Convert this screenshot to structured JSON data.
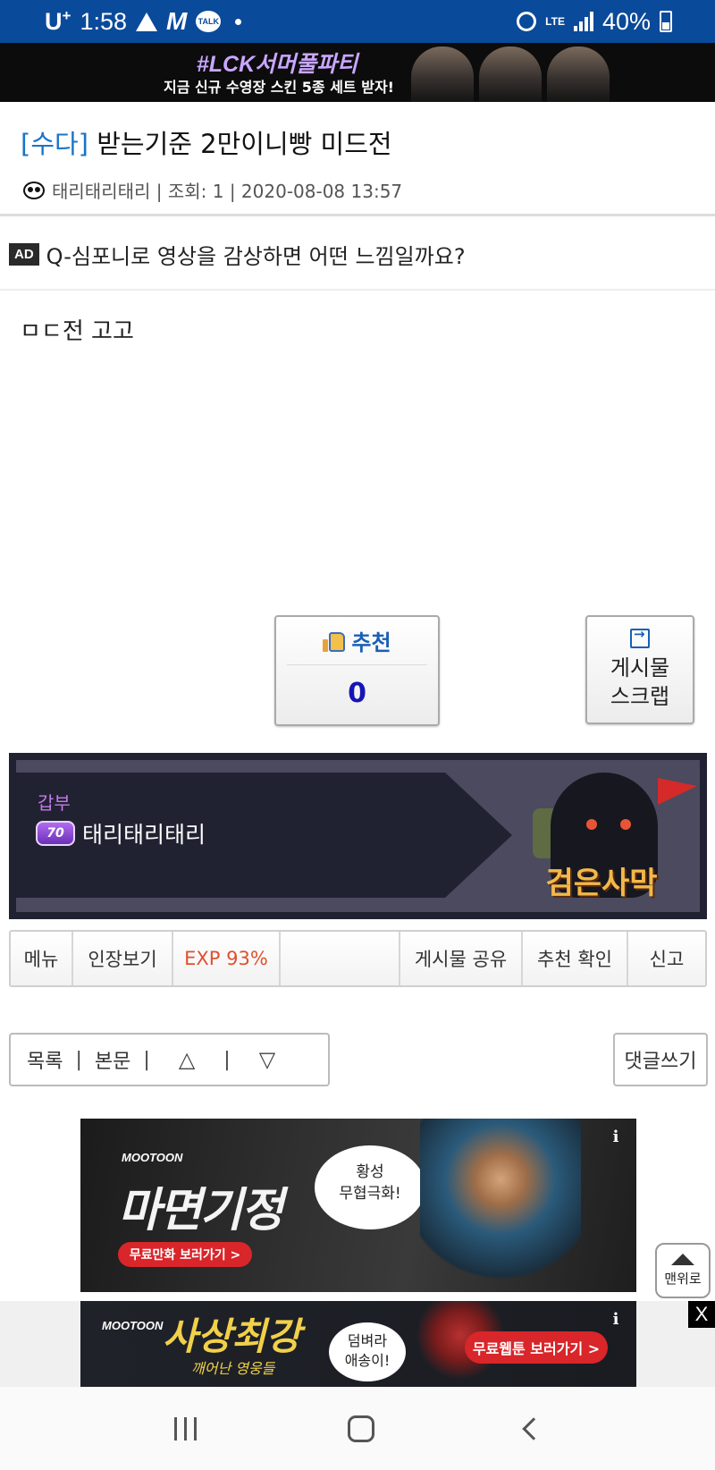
{
  "status_bar": {
    "carrier": "U",
    "carrier_sup": "+",
    "time": "1:58",
    "lte": "LTE",
    "battery": "40%"
  },
  "top_banner": {
    "title": "#LCK서머풀파티",
    "subtitle": "지금 신규 수영장 스킨 5종 세트 받자!"
  },
  "post": {
    "category": "[수다]",
    "title": " 받는기준 2만이니빵 미드전",
    "meta": "태리태리태리 | 조회: 1 | 2020-08-08 13:57",
    "body": "ㅁㄷ전 고고"
  },
  "ad_line": {
    "badge": "AD",
    "text": "Q-심포니로 영상을 감상하면 어떤 느낌일까요?"
  },
  "recommend": {
    "label": "추천",
    "count": "0"
  },
  "scrap": {
    "line1": "게시물",
    "line2": "스크랩"
  },
  "author_card": {
    "grade": "갑부",
    "level": "70",
    "name": "태리태리태리",
    "game_logo": "검은사막"
  },
  "action_bar": {
    "items": [
      "메뉴",
      "인장보기",
      "EXP 93%",
      "",
      "게시물 공유",
      "추천 확인",
      "신고"
    ]
  },
  "nav": {
    "list": "목록",
    "sep": "|",
    "body": "본문",
    "up": "△",
    "down": "▽",
    "reply": "댓글쓰기"
  },
  "ad1": {
    "brand": "MOOTOON",
    "title": "마면기정",
    "button": "무료만화 보러가기 >",
    "bubble_line1": "황성",
    "bubble_line2": "무협극화!",
    "info": "i"
  },
  "ad2": {
    "brand": "MOOTOON",
    "title": "사상최강",
    "subtitle": "깨어난 영웅들",
    "bubble_line1": "덤벼라",
    "bubble_line2": "애송이!",
    "button": "무료웹툰 보러가기 >",
    "info": "i"
  },
  "close_label": "X",
  "top_button": "맨위로"
}
